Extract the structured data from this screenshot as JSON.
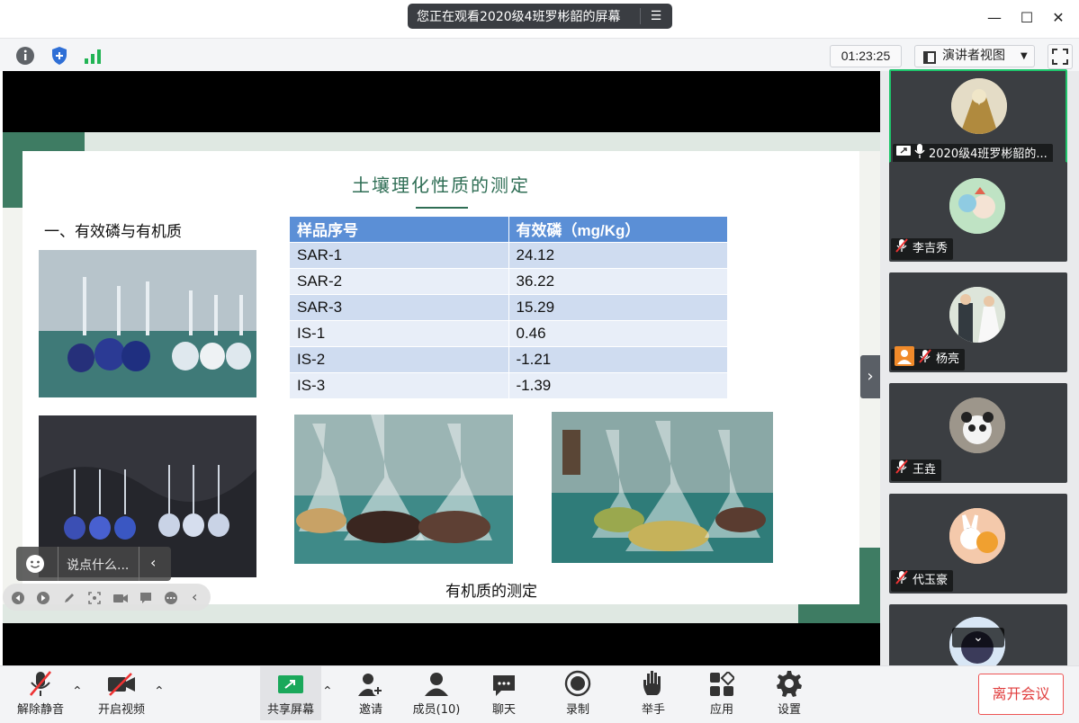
{
  "titlebar": {
    "share_notice": "您正在观看2020级4班罗彬韶的屏幕"
  },
  "toolbar": {
    "timer": "01:23:25",
    "view_mode": "演讲者视图"
  },
  "slide": {
    "title": "土壤理化性质的测定",
    "section_heading": "一、有效磷与有机质",
    "table": {
      "headers": [
        "样品序号",
        "有效磷（mg/Kg）"
      ],
      "rows": [
        [
          "SAR-1",
          "24.12"
        ],
        [
          "SAR-2",
          "36.22"
        ],
        [
          "SAR-3",
          "15.29"
        ],
        [
          "IS-1",
          "0.46"
        ],
        [
          "IS-2",
          "-1.21"
        ],
        [
          "IS-3",
          "-1.39"
        ]
      ]
    },
    "caption": "有机质的测定"
  },
  "chat": {
    "placeholder": "说点什么..."
  },
  "participants": [
    {
      "name": "2020级4班罗彬韶的...",
      "sharing": true,
      "muted": false
    },
    {
      "name": "李吉秀",
      "sharing": false,
      "muted": true
    },
    {
      "name": "杨亮",
      "sharing": false,
      "muted": true
    },
    {
      "name": "王垚",
      "sharing": false,
      "muted": true
    },
    {
      "name": "代玉豪",
      "sharing": false,
      "muted": true
    }
  ],
  "bottom": {
    "unmute": "解除静音",
    "start_video": "开启视频",
    "share_screen": "共享屏幕",
    "invite": "邀请",
    "members": "成员(10)",
    "chat": "聊天",
    "record": "录制",
    "raise_hand": "举手",
    "apps": "应用",
    "settings": "设置",
    "leave": "离开会议"
  },
  "colors": {
    "slide_green": "#3e7c63",
    "table_header": "#5b8fd6",
    "active_border": "#1ec46b",
    "leave_red": "#e03c3c"
  }
}
